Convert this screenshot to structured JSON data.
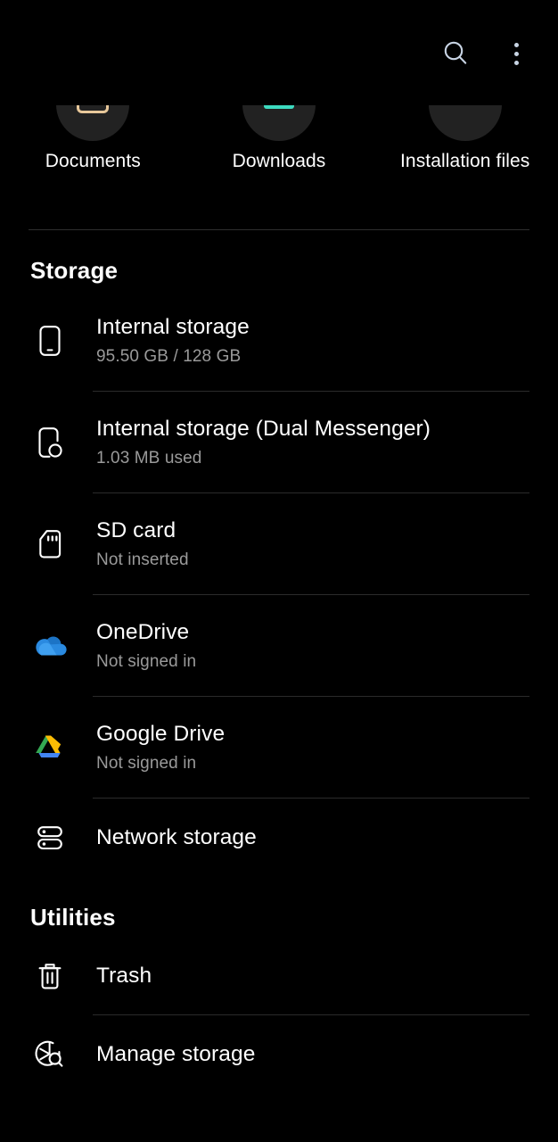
{
  "appbar": {
    "search_icon": "search-icon",
    "overflow_icon": "more-options-icon"
  },
  "shortcuts": [
    {
      "label": "Documents",
      "icon": "documents-folder-icon",
      "color": "#e8c89a"
    },
    {
      "label": "Downloads",
      "icon": "downloads-folder-icon",
      "color": "#3ddbc0"
    },
    {
      "label": "Installation files",
      "icon": "apk-files-icon",
      "color": "#2a2a2a"
    }
  ],
  "sections": [
    {
      "title": "Storage",
      "items": [
        {
          "title": "Internal storage",
          "sub": "95.50 GB / 128 GB",
          "icon": "phone-icon"
        },
        {
          "title": "Internal storage (Dual Messenger)",
          "sub": "1.03 MB used",
          "icon": "dual-messenger-icon"
        },
        {
          "title": "SD card",
          "sub": "Not inserted",
          "icon": "sd-card-icon"
        },
        {
          "title": "OneDrive",
          "sub": "Not signed in",
          "icon": "onedrive-cloud-icon"
        },
        {
          "title": "Google Drive",
          "sub": "Not signed in",
          "icon": "google-drive-icon"
        },
        {
          "title": "Network storage",
          "sub": "",
          "icon": "network-storage-icon"
        }
      ]
    },
    {
      "title": "Utilities",
      "items": [
        {
          "title": "Trash",
          "sub": "",
          "icon": "trash-icon"
        },
        {
          "title": "Manage storage",
          "sub": "",
          "icon": "manage-storage-icon"
        }
      ]
    }
  ],
  "colors": {
    "background": "#000000",
    "text_primary": "#ffffff",
    "text_secondary": "#9a9a9a",
    "divider": "#2b2b2b",
    "accent_search": "#c8d4e4",
    "onedrive_blue": "#2a8ae0",
    "gdrive_green": "#34a853",
    "gdrive_yellow": "#fbbc04",
    "gdrive_blue": "#4285f4"
  }
}
